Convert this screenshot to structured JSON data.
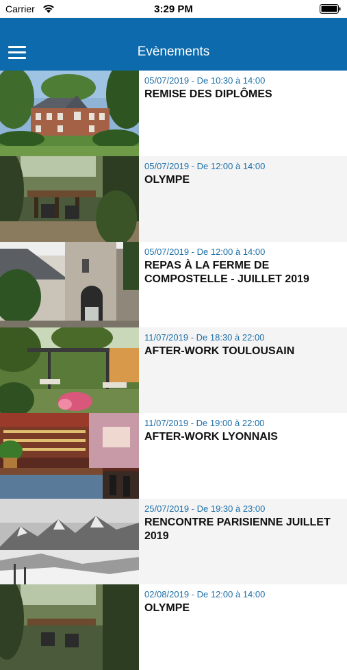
{
  "status_bar": {
    "carrier": "Carrier",
    "time": "3:29 PM"
  },
  "nav": {
    "title": "Evènements",
    "menu_icon": "hamburger-menu-icon"
  },
  "events": [
    {
      "date": "05/07/2019 - De 10:30 à 14:00",
      "title": "REMISE DES DIPLÔMES",
      "image": "manor-house-garden"
    },
    {
      "date": "05/07/2019 - De 12:00 à 14:00",
      "title": "OLYMPE",
      "image": "terrace-dining"
    },
    {
      "date": "05/07/2019 - De 12:00 à 14:00",
      "title": "REPAS À LA FERME DE COMPOSTELLE - JUILLET 2019",
      "image": "stone-farm-gate"
    },
    {
      "date": "11/07/2019 - De 18:30 à 22:00",
      "title": "AFTER-WORK TOULOUSAIN",
      "image": "garden-patio"
    },
    {
      "date": "11/07/2019 - De 19:00 à 22:00",
      "title": "AFTER-WORK LYONNAIS",
      "image": "bar-interior"
    },
    {
      "date": "25/07/2019 - De 19:30 à 23:00",
      "title": "RENCONTRE PARISIENNE JUILLET 2019",
      "image": "snowy-mountains"
    },
    {
      "date": "02/08/2019 - De 12:00 à 14:00",
      "title": "OLYMPE",
      "image": "terrace-dining"
    }
  ]
}
